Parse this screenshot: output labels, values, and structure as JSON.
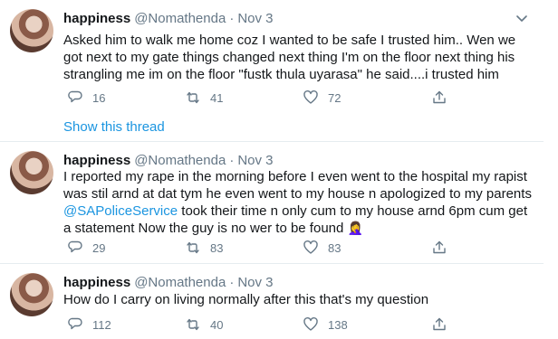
{
  "tweets": [
    {
      "name": "happiness",
      "handle": "@Nomathenda",
      "sep": "·",
      "date": "Nov 3",
      "text": "Asked him to walk me home coz I wanted to be safe I trusted him.. Wen we got next to my gate things changed next thing I'm on the floor next thing his strangling me im on the floor \"fustk thula uyarasa\" he said....i trusted him",
      "replies": "16",
      "retweets": "41",
      "likes": "72",
      "show_thread": "Show this thread"
    },
    {
      "name": "happiness",
      "handle": "@Nomathenda",
      "sep": "·",
      "date": "Nov 3",
      "text_before": "I reported my rape in the morning before I even went to the hospital my rapist was stil arnd at dat tym he even went to my house n apologized to my parents ",
      "mention": "@SAPoliceService",
      "text_after": " took their time n only cum to my house arnd 6pm  cum get a statement Now the guy is no wer to be found ",
      "emoji": "🤦‍♀️",
      "replies": "29",
      "retweets": "83",
      "likes": "83"
    },
    {
      "name": "happiness",
      "handle": "@Nomathenda",
      "sep": "·",
      "date": "Nov 3",
      "text": "How do I carry on living normally after this that's my question",
      "replies": "112",
      "retweets": "40",
      "likes": "138"
    }
  ],
  "colors": {
    "accent": "#1b95e0",
    "muted": "#657786",
    "text": "#14171a",
    "divider": "#e6ecf0"
  },
  "icons": {
    "reply": "reply-icon",
    "retweet": "retweet-icon",
    "like": "heart-icon",
    "share": "share-icon",
    "menu": "chevron-down-icon"
  }
}
